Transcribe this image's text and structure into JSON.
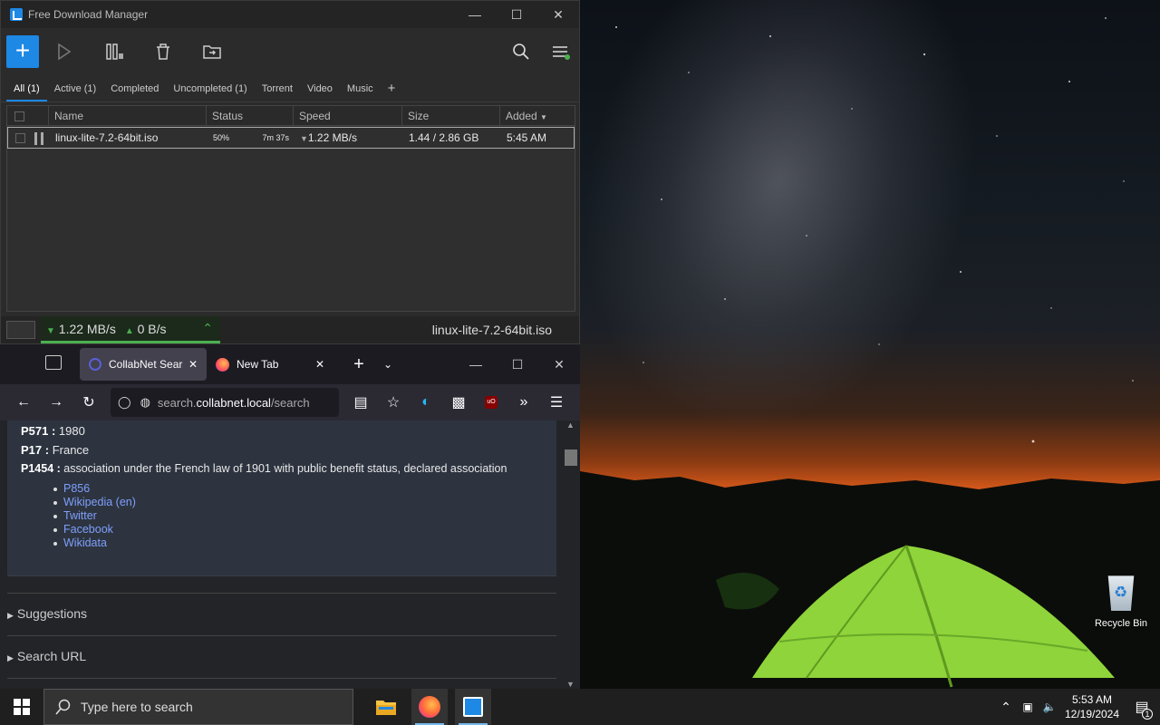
{
  "desktop": {
    "recycle_bin_label": "Recycle Bin"
  },
  "fdm": {
    "title": "Free Download Manager",
    "tabs": [
      "All (1)",
      "Active (1)",
      "Completed",
      "Uncompleted (1)",
      "Torrent",
      "Video",
      "Music"
    ],
    "columns": [
      "Name",
      "Status",
      "Speed",
      "Size",
      "Added"
    ],
    "download": {
      "name": "linux-lite-7.2-64bit.iso",
      "progress": "50%",
      "eta": "7m 37s",
      "speed": "1.22 MB/s",
      "size": "1.44 / 2.86 GB",
      "added": "5:45 AM"
    },
    "status_bar": {
      "down_speed": "1.22 MB/s",
      "up_speed": "0 B/s",
      "current_file": "linux-lite-7.2-64bit.iso"
    }
  },
  "firefox": {
    "tabs": [
      {
        "label": "CollabNet SearXNG"
      },
      {
        "label": "New Tab"
      }
    ],
    "url_prefix": "search.",
    "url_domain": "collabnet.local",
    "url_path": "/search",
    "properties": [
      {
        "key": "P571 :",
        "value": " 1980"
      },
      {
        "key": "P17 :",
        "value": " France"
      },
      {
        "key": "P1454 :",
        "value": " association under the French law of 1901 with public benefit status, declared association"
      }
    ],
    "links": [
      "P856",
      "Wikipedia (en)",
      "Twitter",
      "Facebook",
      "Wikidata"
    ],
    "sections": [
      "Suggestions",
      "Search URL"
    ]
  },
  "taskbar": {
    "search_placeholder": "Type here to search",
    "time": "5:53 AM",
    "date": "12/19/2024",
    "notification_count": "1"
  },
  "colors": {
    "accent": "#1e88e5",
    "link": "#7f9ffc",
    "speed_green": "#4caf50"
  }
}
